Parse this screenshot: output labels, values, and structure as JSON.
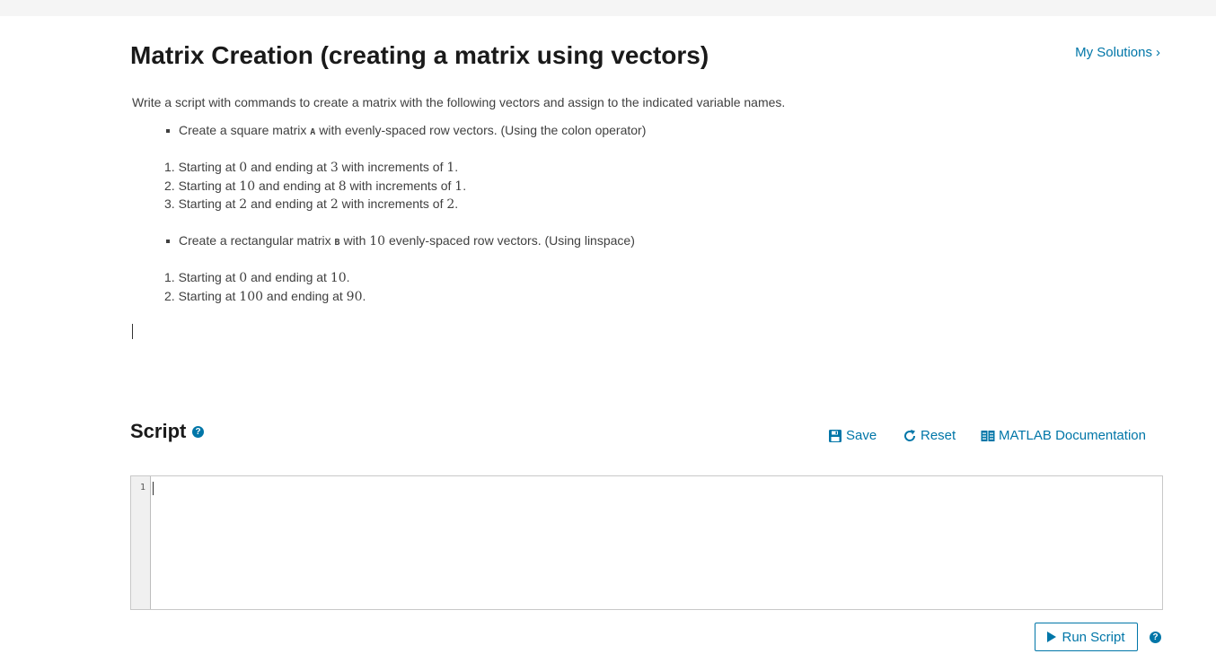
{
  "header": {
    "title": "Matrix Creation (creating a matrix using vectors)",
    "my_solutions": "My Solutions",
    "my_solutions_chevron": "›"
  },
  "problem": {
    "description": "Write a script with commands to create a matrix with the following vectors and assign to the indicated variable names.",
    "bullet1": {
      "pre": "Create a square matrix ",
      "var": "A",
      "post": " with evenly-spaced row vectors. (Using the colon operator)"
    },
    "steps_a": [
      {
        "num": "1.",
        "t1": "Starting at ",
        "v1": "0",
        "t2": " and ending at ",
        "v2": "3",
        "t3": " with increments of ",
        "v3": "1",
        "end": "."
      },
      {
        "num": "2.",
        "t1": "Starting at ",
        "v1": "10",
        "t2": " and ending at ",
        "v2": "8",
        "t3": " with increments of ",
        "v3": "1",
        "end": "."
      },
      {
        "num": "3.",
        "t1": "Starting at ",
        "v1": "2",
        "t2": " and ending at ",
        "v2": "2",
        "t3": " with increments of ",
        "v3": "2",
        "end": "."
      }
    ],
    "bullet2": {
      "pre": "Create a rectangular matrix ",
      "var": "B",
      "mid": " with ",
      "num": "10",
      "post": " evenly-spaced row vectors. (Using linspace)"
    },
    "steps_b": [
      {
        "num": "1.",
        "t1": "Starting at ",
        "v1": "0",
        "t2": " and ending at ",
        "v2": "10",
        "end": "."
      },
      {
        "num": "2.",
        "t1": "Starting at ",
        "v1": "100",
        "t2": " and ending at ",
        "v2": "90",
        "end": "."
      }
    ]
  },
  "script": {
    "title": "Script",
    "help": "?",
    "save_label": "Save",
    "reset_label": "Reset",
    "docs_label": "MATLAB Documentation",
    "line_number": "1",
    "code": ""
  },
  "run": {
    "label": "Run Script",
    "help": "?"
  },
  "colors": {
    "accent": "#0076a8",
    "title": "#1a1a1a",
    "body_text": "#404040"
  },
  "icons": {
    "save": "floppy-disk-icon",
    "reset": "refresh-icon",
    "docs": "book-icon",
    "run": "play-icon",
    "help": "question-circle-icon"
  }
}
